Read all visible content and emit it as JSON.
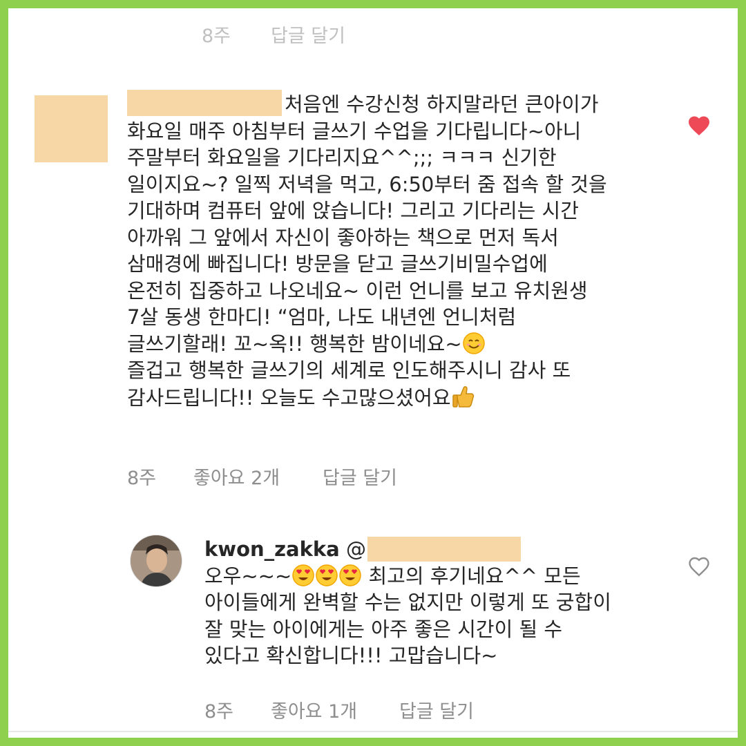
{
  "top_meta": {
    "time": "8주",
    "reply": "답글 달기"
  },
  "comment": {
    "lines": [
      "처음엔 수강신청 하지말라던 큰아이가",
      "화요일 매주 아침부터 글쓰기 수업을 기다립니다~아니",
      "주말부터 화요일을 기다리지요^^;;; ㅋㅋㅋ 신기한",
      "일이지요~? 일찍 저녁을 먹고, 6:50부터 줌 접속 할 것을",
      "기대하며 컴퓨터 앞에 앉습니다! 그리고 기다리는 시간",
      "아까워 그 앞에서 자신이 좋아하는 책으로 먼저 독서",
      "삼매경에 빠집니다! 방문을 닫고 글쓰기비밀수업에",
      "온전히 집중하고 나오네요~ 이런 언니를 보고 유치원생",
      "7살 동생 한마디! “엄마, 나도 내년엔 언니처럼",
      "글쓰기할래! 꼬~옥!! 행복한 밤이네요~",
      "즐겁고 행복한 글쓰기의 세계로 인도해주시니 감사 또",
      "감사드립니다!! 오늘도 수고많으셨어요"
    ],
    "time": "8주",
    "likes": "좋아요 2개",
    "reply": "답글 달기",
    "icons": {
      "like": "heart-filled-icon",
      "smile": "smiling-face-emoji",
      "thumbs": "thumbs-up-emoji"
    },
    "colors": {
      "heart": "#ed4956",
      "redaction": "#f8d7a6"
    }
  },
  "reply": {
    "username": "kwon_zakka",
    "mention_prefix": "@",
    "line1_start": "오우~~~",
    "line1_end": "최고의 후기네요^^ 모든",
    "lines": [
      "아이들에게 완벽할 수는 없지만 이렇게 또 궁합이",
      "잘 맞는 아이에게는 아주 좋은 시간이 될 수",
      "있다고 확신합니다!!! 고맙습니다~"
    ],
    "time": "8주",
    "likes": "좋아요 1개",
    "reply": "답글 달기",
    "icons": {
      "like": "heart-outline-icon",
      "emoji": "heart-eyes-emoji"
    }
  },
  "frame": {
    "border_color": "#8fd14f"
  }
}
